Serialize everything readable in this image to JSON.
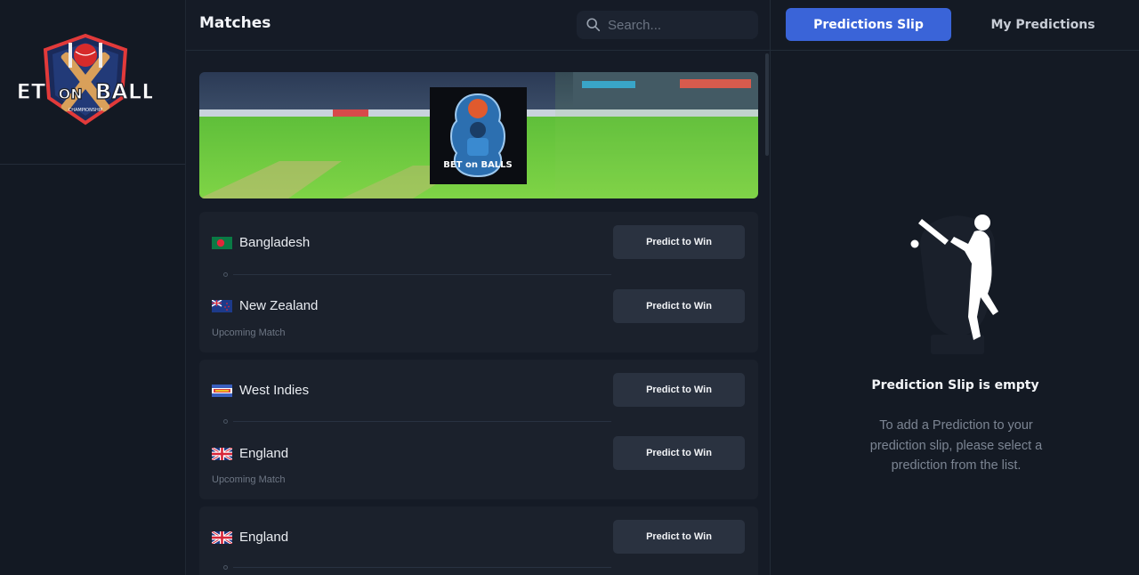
{
  "app": {
    "logo_text": [
      "BET",
      "ON",
      "BALLS"
    ],
    "logo_sub": "CHAMPIONSHIP"
  },
  "matches_panel": {
    "title": "Matches",
    "search_placeholder": "Search..."
  },
  "banner": {
    "logo_text": "BET on BALLS"
  },
  "matches": [
    {
      "team1": {
        "name": "Bangladesh",
        "flag": "bangladesh-flag"
      },
      "team2": {
        "name": "New Zealand",
        "flag": "new-zealand-flag"
      },
      "status": "Upcoming Match",
      "button_label": "Predict to Win"
    },
    {
      "team1": {
        "name": "West Indies",
        "flag": "west-indies-flag"
      },
      "team2": {
        "name": "England",
        "flag": "uk-flag"
      },
      "status": "Upcoming Match",
      "button_label": "Predict to Win"
    },
    {
      "team1": {
        "name": "England",
        "flag": "uk-flag"
      },
      "button_label": "Predict to Win"
    }
  ],
  "right_panel": {
    "tab_active": "Predictions Slip",
    "tab_other": "My Predictions",
    "empty_title": "Prediction Slip is empty",
    "empty_text": "To add a Prediction to your prediction slip, please select a prediction from the list."
  },
  "colors": {
    "accent": "#3a64d8",
    "background": "#141a24",
    "card": "#1b212c",
    "button": "#2a3240"
  }
}
